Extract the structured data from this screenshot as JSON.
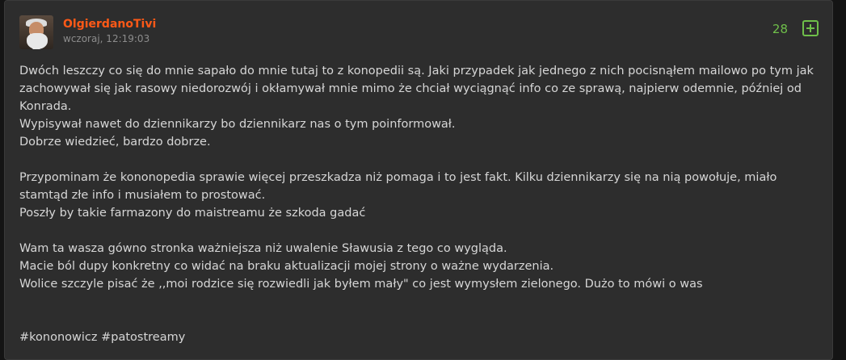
{
  "post": {
    "author": "OlgierdanoTivi",
    "timestamp": "wczoraj, 12:19:03",
    "votes": "28",
    "paragraphs": [
      {
        "lines": [
          "Dwóch leszczy co się do mnie sapało do mnie tutaj to z konopedii są. Jaki przypadek jak jednego z nich pocisnąłem mailowo po tym jak zachowywał się jak rasowy niedorozwój i okłamywał mnie mimo że chciał wyciągnąć info co ze sprawą, najpierw odemnie, później od Konrada.",
          "Wypisywał nawet do dziennikarzy bo dziennikarz nas o tym poinformował.",
          "Dobrze wiedzieć, bardzo dobrze."
        ]
      },
      {
        "lines": [
          "Przypominam że kononopedia sprawie więcej przeszkadza niż pomaga i to jest fakt. Kilku dziennikarzy się na nią powołuje, miało stamtąd złe info i musiałem to prostować.",
          "Poszły by takie farmazony do maistreamu że szkoda gadać"
        ]
      },
      {
        "lines": [
          "Wam ta wasza gówno stronka ważniejsza niż uwalenie Sławusia z tego co wygląda.",
          "Macie ból dupy konkretny co widać na braku aktualizacji mojej strony o ważne wydarzenia.",
          "Wolice szczyle pisać że ,,moi rodzice się rozwiedli jak byłem mały\" co jest wymysłem zielonego. Dużo to mówi o was"
        ]
      }
    ],
    "tags": [
      "#kononowicz",
      "#patostreamy"
    ]
  },
  "colors": {
    "author": "#ff5917",
    "vote_accent": "#6fbf4a",
    "card_bg": "#2d2d2d",
    "page_bg": "#141414"
  },
  "icons": {
    "avatar": "user-avatar",
    "plus": "plus-square-icon"
  }
}
